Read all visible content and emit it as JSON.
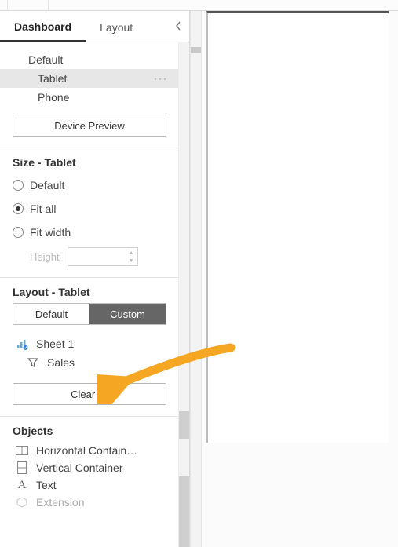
{
  "tabs": {
    "dashboard": "Dashboard",
    "layout": "Layout"
  },
  "device": {
    "default": "Default",
    "tablet": "Tablet",
    "phone": "Phone",
    "preview_button": "Device Preview",
    "more": "···"
  },
  "size": {
    "title": "Size - Tablet",
    "options": {
      "default": "Default",
      "fit_all": "Fit all",
      "fit_width": "Fit width"
    },
    "height_label": "Height"
  },
  "layout_panel": {
    "title": "Layout - Tablet",
    "seg_default": "Default",
    "seg_custom": "Custom",
    "items": {
      "sheet": "Sheet 1",
      "sales": "Sales"
    },
    "clear": "Clear all"
  },
  "objects": {
    "title": "Objects",
    "items": {
      "horizontal": "Horizontal Contain…",
      "vertical": "Vertical Container",
      "text": "Text",
      "extension": "Extension"
    }
  }
}
